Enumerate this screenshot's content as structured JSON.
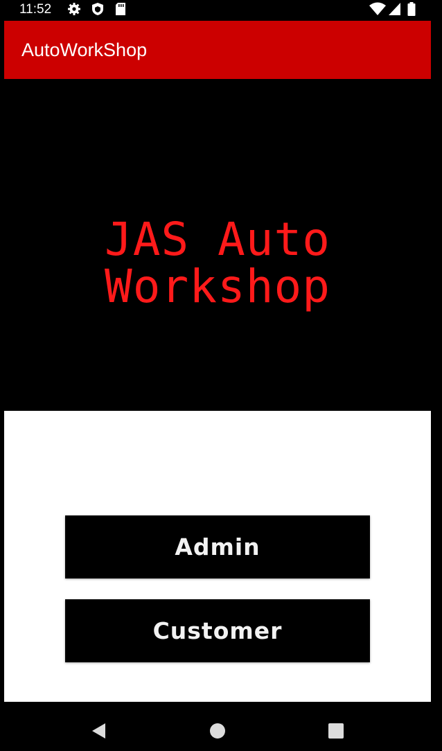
{
  "status_bar": {
    "time": "11:52",
    "left_icons": [
      "gear-icon",
      "shield-icon",
      "sd-card-icon"
    ],
    "right_icons": [
      "wifi-icon",
      "signal-icon",
      "battery-icon"
    ]
  },
  "app_bar": {
    "title": "AutoWorkShop",
    "color": "#cc0000"
  },
  "hero": {
    "line1": "JAS Auto",
    "line2": "Workshop",
    "color": "#ff1a1a"
  },
  "buttons": {
    "admin_label": "Admin",
    "customer_label": "Customer"
  },
  "nav_bar": {
    "icons": [
      "back-icon",
      "home-icon",
      "recents-icon"
    ]
  }
}
